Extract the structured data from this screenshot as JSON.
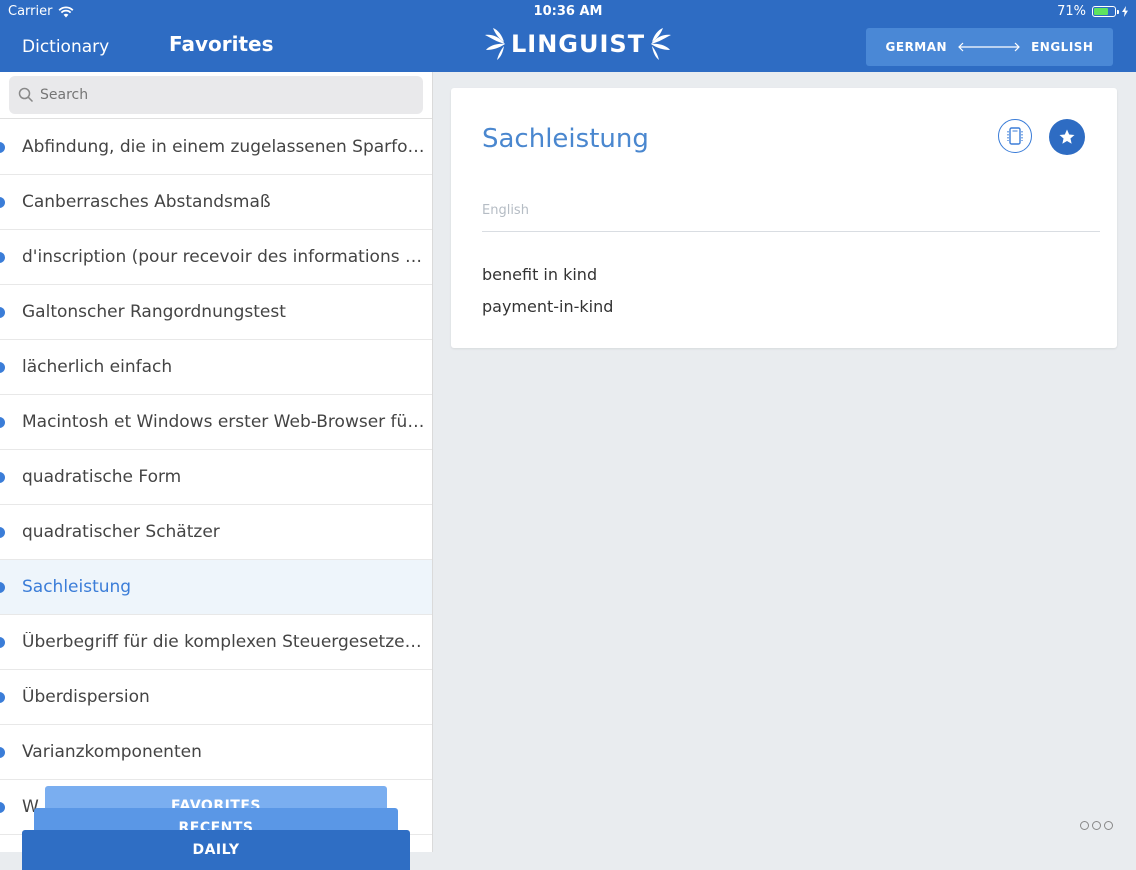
{
  "status": {
    "carrier": "Carrier",
    "time": "10:36 AM",
    "battery": "71%",
    "battery_level": 0.71
  },
  "header": {
    "dictionary_label": "Dictionary",
    "favorites_title": "Favorites",
    "brand": "LINGUIST",
    "lang_from": "GERMAN",
    "lang_to": "ENGLISH"
  },
  "search": {
    "placeholder": "Search"
  },
  "list": {
    "items": [
      "Abfindung, die in einem zugelassenen Sparfonds angelegt wird",
      "Canberrasches Abstandsmaß",
      "d'inscription (pour recevoir des informations via e-mail)",
      "Galtonscher Rangordnungstest",
      "lächerlich einfach",
      "Macintosh et Windows erster Web-Browser für Windows",
      "quadratische Form",
      "quadratischer Schätzer",
      "Sachleistung",
      "Überbegriff für die komplexen Steuergesetze der USA",
      "Überdispersion",
      "Varianzkomponenten",
      "W"
    ],
    "active_index": 8
  },
  "tabs": {
    "favorites": "FAVORITES",
    "recents": "RECENTS",
    "daily": "DAILY"
  },
  "detail": {
    "title": "Sachleistung",
    "language": "English",
    "meanings": [
      "benefit in kind",
      "payment-in-kind"
    ]
  },
  "colors": {
    "header": "#2e6cc3",
    "accent": "#3b7dd8"
  }
}
